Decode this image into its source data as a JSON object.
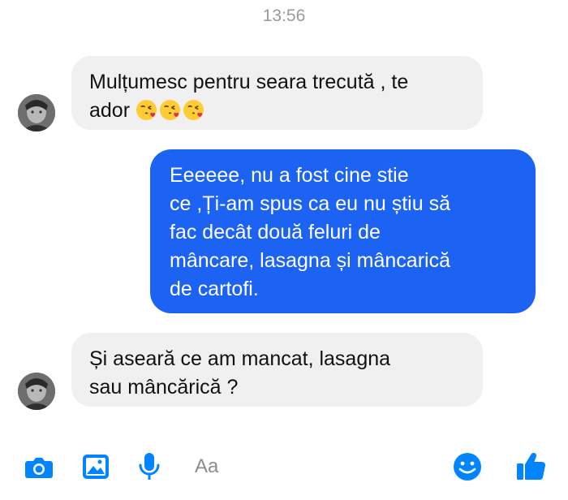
{
  "conversation": {
    "timestamp": "13:56",
    "messages": [
      {
        "direction": "incoming",
        "lines": [
          "Mulțumesc pentru seara trecută , te",
          "ador"
        ],
        "emoji": [
          "kissing-heart",
          "kissing-heart",
          "kissing-heart"
        ]
      },
      {
        "direction": "outgoing",
        "lines": [
          "Eeeeee, nu a fost cine stie",
          "ce ,Ți-am spus ca eu nu știu să",
          "fac decât două feluri de",
          "mâncare, lasagna și mâncarică",
          "de cartofi."
        ]
      },
      {
        "direction": "incoming",
        "lines": [
          "Și aseară ce am mancat, lasagna",
          "sau mâncărică ?"
        ]
      }
    ]
  },
  "composer": {
    "placeholder": "Aa",
    "icons": [
      "camera-icon",
      "image-icon",
      "microphone-icon",
      "emoji-icon",
      "thumbs-up-icon"
    ]
  },
  "colors": {
    "accent": "#0084ff",
    "outgoing_bubble": "#1c63f4",
    "incoming_bubble": "#f1f0f0",
    "timestamp": "#999999"
  }
}
